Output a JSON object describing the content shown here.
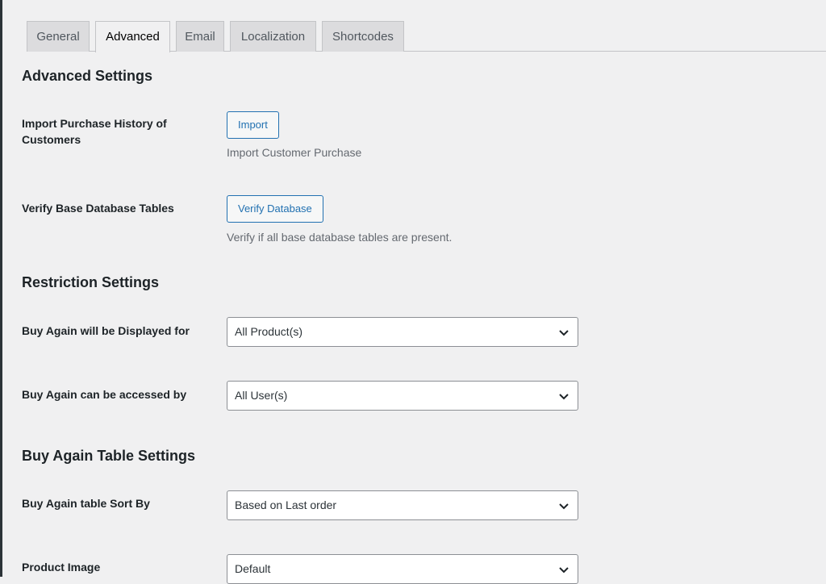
{
  "tabs": [
    {
      "label": "General",
      "active": false
    },
    {
      "label": "Advanced",
      "active": true
    },
    {
      "label": "Email",
      "active": false
    },
    {
      "label": "Localization",
      "active": false
    },
    {
      "label": "Shortcodes",
      "active": false
    }
  ],
  "advanced": {
    "heading": "Advanced Settings",
    "import_label": "Import Purchase History of Customers",
    "import_button": "Import",
    "import_desc": "Import Customer Purchase",
    "verify_label": "Verify Base Database Tables",
    "verify_button": "Verify Database",
    "verify_desc": "Verify if all base database tables are present."
  },
  "restriction": {
    "heading": "Restriction Settings",
    "displayed_for_label": "Buy Again will be Displayed for",
    "displayed_for_value": "All Product(s)",
    "accessed_by_label": "Buy Again can be accessed by",
    "accessed_by_value": "All User(s)"
  },
  "table_settings": {
    "heading": "Buy Again Table Settings",
    "sort_by_label": "Buy Again table Sort By",
    "sort_by_value": "Based on Last order",
    "product_image_label": "Product Image",
    "product_image_value": "Default"
  },
  "colors": {
    "accent": "#2271b1",
    "background": "#f0f0f1",
    "tab_inactive": "#dcdcde"
  },
  "icons": {
    "select_arrow": "chevron-down-icon"
  }
}
